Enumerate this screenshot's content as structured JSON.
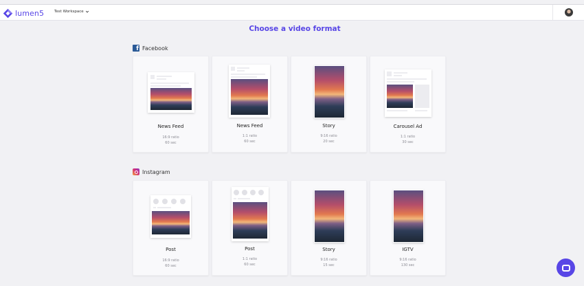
{
  "app": {
    "brand_name": "lumen5",
    "workspace": "Test Workspace",
    "colors": {
      "accent": "#5846e6",
      "facebook": "#2b5a97",
      "instagram": "#d22e7a"
    }
  },
  "page": {
    "title": "Choose a video format"
  },
  "sections": [
    {
      "name": "Facebook",
      "icon": "facebook-icon",
      "cards": [
        {
          "title": "News Feed",
          "ratio": "16:9 ratio",
          "duration": "60 sec"
        },
        {
          "title": "News Feed",
          "ratio": "1:1 ratio",
          "duration": "60 sec"
        },
        {
          "title": "Story",
          "ratio": "9:16 ratio",
          "duration": "20 sec"
        },
        {
          "title": "Carousel Ad",
          "ratio": "1:1 ratio",
          "duration": "30 sec"
        }
      ]
    },
    {
      "name": "Instagram",
      "icon": "instagram-icon",
      "cards": [
        {
          "title": "Post",
          "ratio": "16:9 ratio",
          "duration": "60 sec"
        },
        {
          "title": "Post",
          "ratio": "1:1 ratio",
          "duration": "60 sec"
        },
        {
          "title": "Story",
          "ratio": "9:16 ratio",
          "duration": "15 sec"
        },
        {
          "title": "IGTV",
          "ratio": "9:16 ratio",
          "duration": "130 sec"
        }
      ]
    }
  ],
  "icons": {
    "chat": "chat-icon",
    "avatar": "user-avatar",
    "chevron": "chevron-down-icon"
  }
}
